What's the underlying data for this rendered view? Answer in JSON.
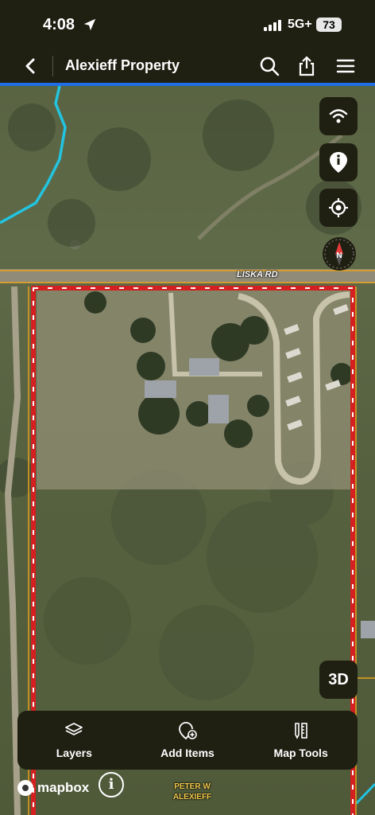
{
  "status_bar": {
    "time": "4:08",
    "network": "5G+",
    "battery": "73"
  },
  "nav": {
    "title": "Alexieff Property"
  },
  "map": {
    "road_label": "LISKA RD",
    "owner_label_line1": "PETER W",
    "owner_label_line2": "ALEXIEFF",
    "compass_letter": "N",
    "btn_3d": "3D",
    "attribution": "mapbox",
    "info_symbol": "i",
    "colors": {
      "boundary": "#d42020",
      "water": "#22c4e0",
      "parcel_line": "#e8a21a",
      "accent": "#1f6ee8"
    }
  },
  "toolbar": {
    "items": [
      {
        "label": "Layers",
        "icon": "layers-icon"
      },
      {
        "label": "Add Items",
        "icon": "add-location-icon"
      },
      {
        "label": "Map Tools",
        "icon": "map-tools-icon"
      }
    ]
  },
  "right_buttons": [
    "wifi-icon",
    "info-pin-icon",
    "locate-icon",
    "compass-icon"
  ]
}
